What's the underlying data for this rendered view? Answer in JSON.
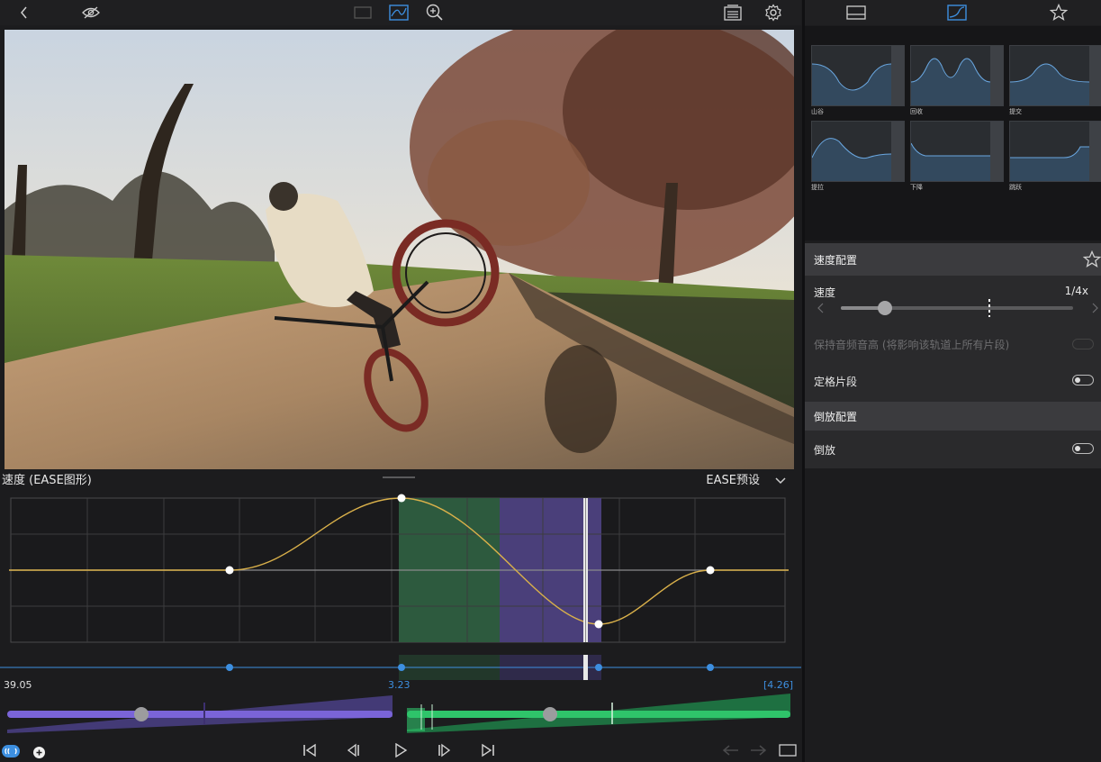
{
  "toolbar": {
    "left_icons": [
      "back-chevron-icon",
      "visibility-eye-icon"
    ],
    "center_icons": [
      "frame-view-icon",
      "curve-view-icon",
      "zoom-in-icon"
    ],
    "right_icons": [
      "inspector-list-icon",
      "settings-gear-icon"
    ]
  },
  "speed_graph": {
    "title": "速度 (EASE图形)",
    "preset_label": "EASE预设",
    "left_time": "39.05",
    "mid_time": "3.23",
    "right_time": "[4.26]"
  },
  "right_panel": {
    "tabs": [
      "clip-tab-icon",
      "curve-tab-icon",
      "favorite-star-icon"
    ],
    "presets": [
      {
        "label": "山谷"
      },
      {
        "label": "回收"
      },
      {
        "label": "提交"
      },
      {
        "label": "提拉"
      },
      {
        "label": "下降"
      },
      {
        "label": "跳跃"
      }
    ],
    "speed_config_title": "速度配置",
    "speed_label": "速度",
    "speed_value": "1/4x",
    "speed_slider_level": 0.19,
    "keep_pitch_label": "保持音频音高 (将影响该轨道上所有片段)",
    "freeze_label": "定格片段",
    "reverse_config_title": "倒放配置",
    "reverse_label": "倒放"
  },
  "colors": {
    "accent_blue": "#3d8fe0",
    "curve_yellow": "#d9b04a",
    "green_region": "#2d5a3e",
    "purple_region": "#4a3f7a",
    "green_ramp": "#2fc46a",
    "purple_ramp": "#6b56c9"
  }
}
